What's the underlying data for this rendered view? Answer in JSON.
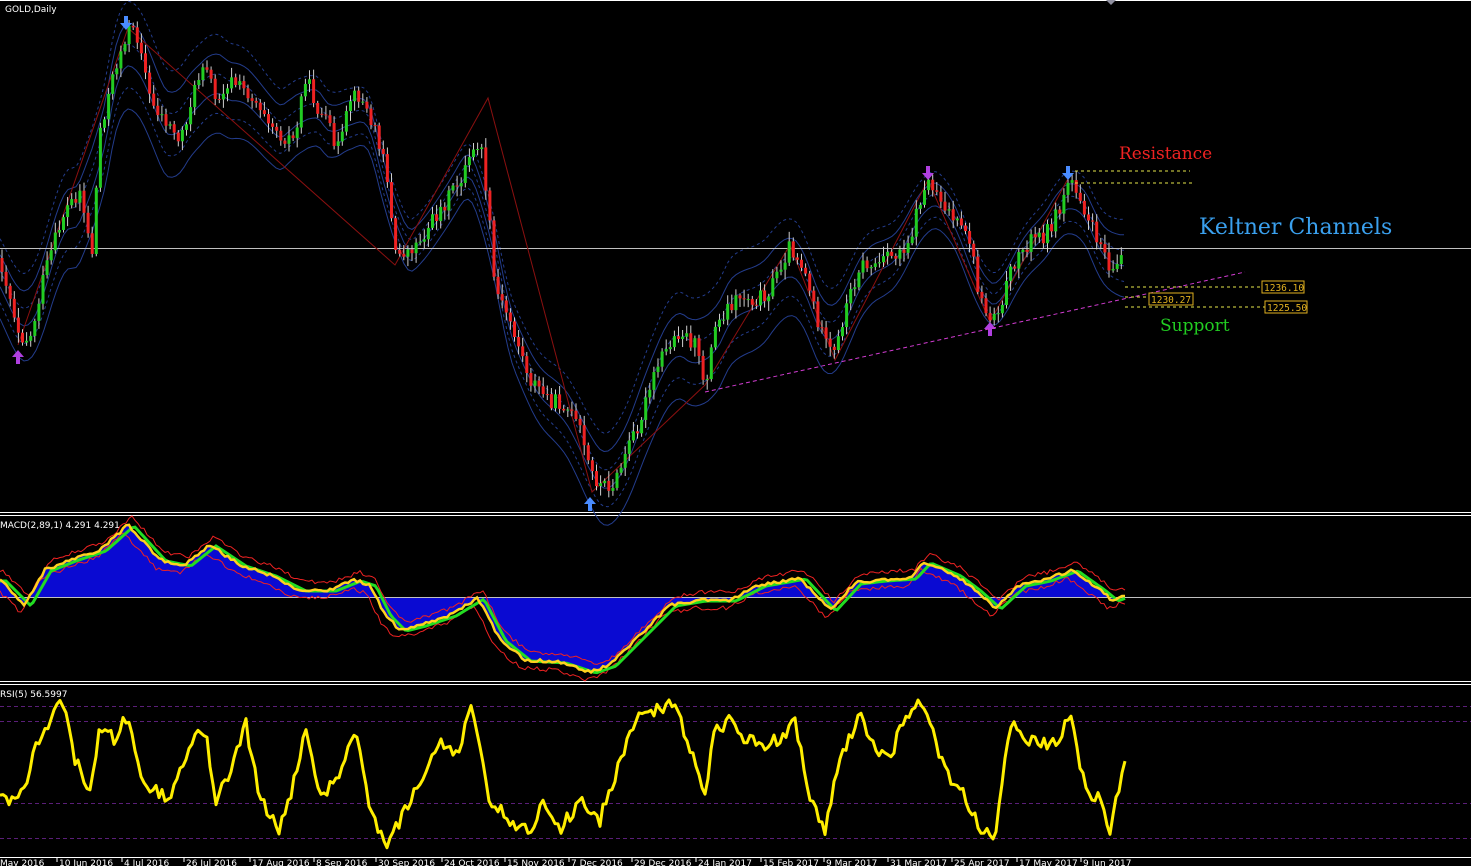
{
  "window": {
    "title": "GOLD,Daily"
  },
  "main": {
    "annotations": {
      "resistance": "Resistance",
      "keltner": "Keltner Channels",
      "support": "Support"
    },
    "price_tags": [
      "1236.10",
      "1230.27",
      "1225.50"
    ]
  },
  "macd": {
    "label": "MACD(2,89,1) 4.291 4.291"
  },
  "rsi": {
    "label": "RSI(5) 56.5997"
  },
  "xaxis": {
    "dates": [
      "May 2016",
      "10 Jun 2016",
      "4 Jul 2016",
      "26 Jul 2016",
      "17 Aug 2016",
      "8 Sep 2016",
      "30 Sep 2016",
      "24 Oct 2016",
      "15 Nov 2016",
      "7 Dec 2016",
      "29 Dec 2016",
      "24 Jan 2017",
      "15 Feb 2017",
      "9 Mar 2017",
      "31 Mar 2017",
      "25 Apr 2017",
      "17 May 2017",
      "9 Jun 2017"
    ]
  },
  "colors": {
    "bull": "#22cc22",
    "bear": "#ee2222",
    "channel": "#233c8c",
    "macd_fill": "#0a0ad2",
    "macd_line": "#ffd21e",
    "signal": "#22dd22",
    "rsi": "#ffee00",
    "resistance": "#ee2222",
    "keltner_label": "#3aa0ee",
    "support": "#22cc22",
    "trendline": "#d23cd2"
  },
  "chart_data": [
    {
      "type": "candlestick",
      "title": "GOLD,Daily",
      "x": [
        "May 2016",
        "10 Jun 2016",
        "4 Jul 2016",
        "26 Jul 2016",
        "17 Aug 2016",
        "8 Sep 2016",
        "30 Sep 2016",
        "24 Oct 2016",
        "15 Nov 2016",
        "7 Dec 2016",
        "29 Dec 2016",
        "24 Jan 2017",
        "15 Feb 2017",
        "9 Mar 2017",
        "31 Mar 2017",
        "25 Apr 2017",
        "17 May 2017",
        "9 Jun 2017"
      ],
      "close": [
        1240,
        1290,
        1360,
        1330,
        1345,
        1330,
        1265,
        1270,
        1230,
        1130,
        1165,
        1210,
        1240,
        1210,
        1255,
        1275,
        1260,
        1280
      ],
      "levels": {
        "resistance": "Resistance",
        "support": "Support",
        "price_tags": [
          1236.1,
          1230.27,
          1225.5
        ]
      },
      "overlays": [
        "Keltner Channels"
      ]
    },
    {
      "type": "area",
      "title": "MACD(2,89,1) 4.291 4.291",
      "x": [
        "May 2016",
        "10 Jun 2016",
        "4 Jul 2016",
        "26 Jul 2016",
        "17 Aug 2016",
        "8 Sep 2016",
        "30 Sep 2016",
        "24 Oct 2016",
        "15 Nov 2016",
        "7 Dec 2016",
        "29 Dec 2016",
        "24 Jan 2017",
        "15 Feb 2017",
        "9 Mar 2017",
        "31 Mar 2017",
        "25 Apr 2017",
        "17 May 2017",
        "9 Jun 2017"
      ],
      "values": [
        0,
        35,
        75,
        45,
        33,
        25,
        -25,
        5,
        -45,
        -70,
        -25,
        0,
        18,
        -10,
        30,
        0,
        20,
        4.291
      ]
    },
    {
      "type": "line",
      "title": "RSI(5) 56.5997",
      "x": [
        "May 2016",
        "10 Jun 2016",
        "4 Jul 2016",
        "26 Jul 2016",
        "17 Aug 2016",
        "8 Sep 2016",
        "30 Sep 2016",
        "24 Oct 2016",
        "15 Nov 2016",
        "7 Dec 2016",
        "29 Dec 2016",
        "24 Jan 2017",
        "15 Feb 2017",
        "9 Mar 2017",
        "31 Mar 2017",
        "25 Apr 2017",
        "17 May 2017",
        "9 Jun 2017"
      ],
      "values": [
        20,
        85,
        70,
        82,
        40,
        80,
        15,
        80,
        25,
        20,
        85,
        72,
        68,
        30,
        88,
        20,
        72,
        56.5997
      ],
      "ylim": [
        0,
        100
      ]
    }
  ]
}
